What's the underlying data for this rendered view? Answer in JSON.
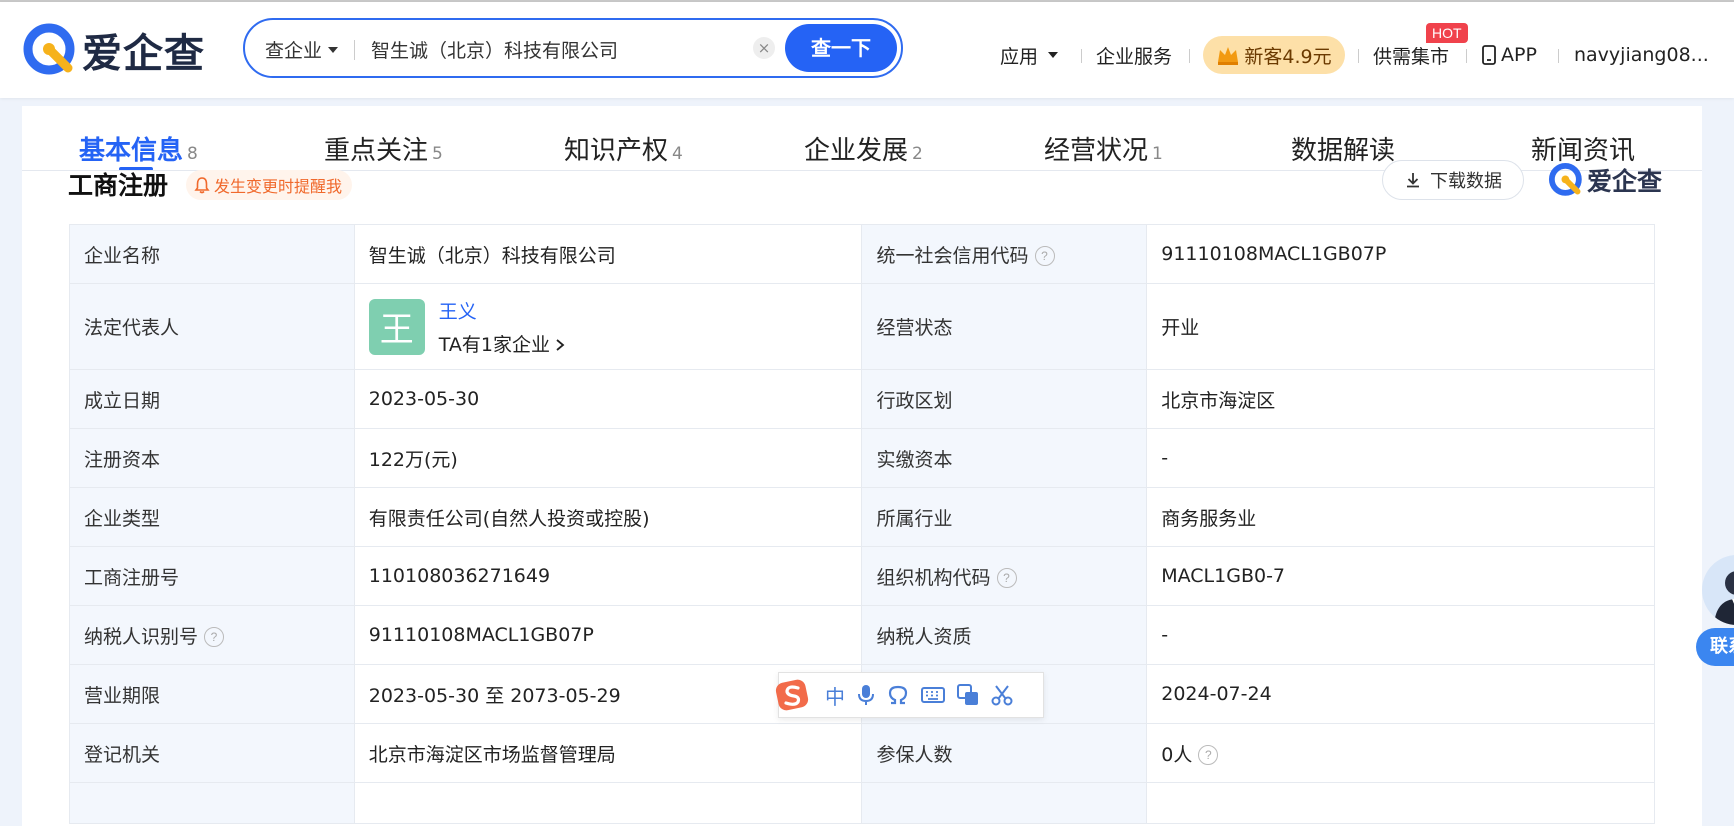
{
  "header": {
    "logo_text": "爱企查",
    "search": {
      "type_label": "查企业",
      "query": "智生诚（北京）科技有限公司",
      "button_label": "查一下"
    },
    "nav": {
      "apps": "应用",
      "enterprise_service": "企业服务",
      "promo": "新客4.9元",
      "market": "供需集市",
      "hot_badge": "HOT",
      "app": "APP",
      "user": "navyjiang08..."
    }
  },
  "tabs": [
    {
      "label": "基本信息",
      "count": "8",
      "active": true
    },
    {
      "label": "重点关注",
      "count": "5"
    },
    {
      "label": "知识产权",
      "count": "4"
    },
    {
      "label": "企业发展",
      "count": "2"
    },
    {
      "label": "经营状况",
      "count": "1"
    },
    {
      "label": "数据解读",
      "count": ""
    },
    {
      "label": "新闻资讯",
      "count": ""
    }
  ],
  "section": {
    "title": "工商注册",
    "remind": "发生变更时提醒我",
    "download": "下载数据",
    "watermark": "爱企查"
  },
  "info": {
    "rows": [
      {
        "l1": "企业名称",
        "v1": "智生诚（北京）科技有限公司",
        "l2": "统一社会信用代码",
        "v2": "91110108MACL1GB07P"
      },
      {
        "l1": "法定代表人",
        "rep_avatar": "王",
        "rep_name": "王义",
        "rep_sub": "TA有1家企业",
        "l2": "经营状态",
        "v2": "开业"
      },
      {
        "l1": "成立日期",
        "v1": "2023-05-30",
        "l2": "行政区划",
        "v2": "北京市海淀区"
      },
      {
        "l1": "注册资本",
        "v1": "122万(元)",
        "l2": "实缴资本",
        "v2": "-"
      },
      {
        "l1": "企业类型",
        "v1": "有限责任公司(自然人投资或控股)",
        "l2": "所属行业",
        "v2": "商务服务业"
      },
      {
        "l1": "工商注册号",
        "v1": "110108036271649",
        "l2": "组织机构代码",
        "v2": "MACL1GB0-7"
      },
      {
        "l1": "纳税人识别号",
        "v1": "91110108MACL1GB07P",
        "l2": "纳税人资质",
        "v2": "-"
      },
      {
        "l1": "营业期限",
        "v1": "2023-05-30 至 2073-05-29",
        "l2": "",
        "v2": "2024-07-24"
      },
      {
        "l1": "登记机关",
        "v1": "北京市海淀区市场监督管理局",
        "l2": "参保人数",
        "v2": "0人"
      }
    ]
  },
  "ime": {
    "lang": "中"
  },
  "float": {
    "contact": "联系"
  }
}
